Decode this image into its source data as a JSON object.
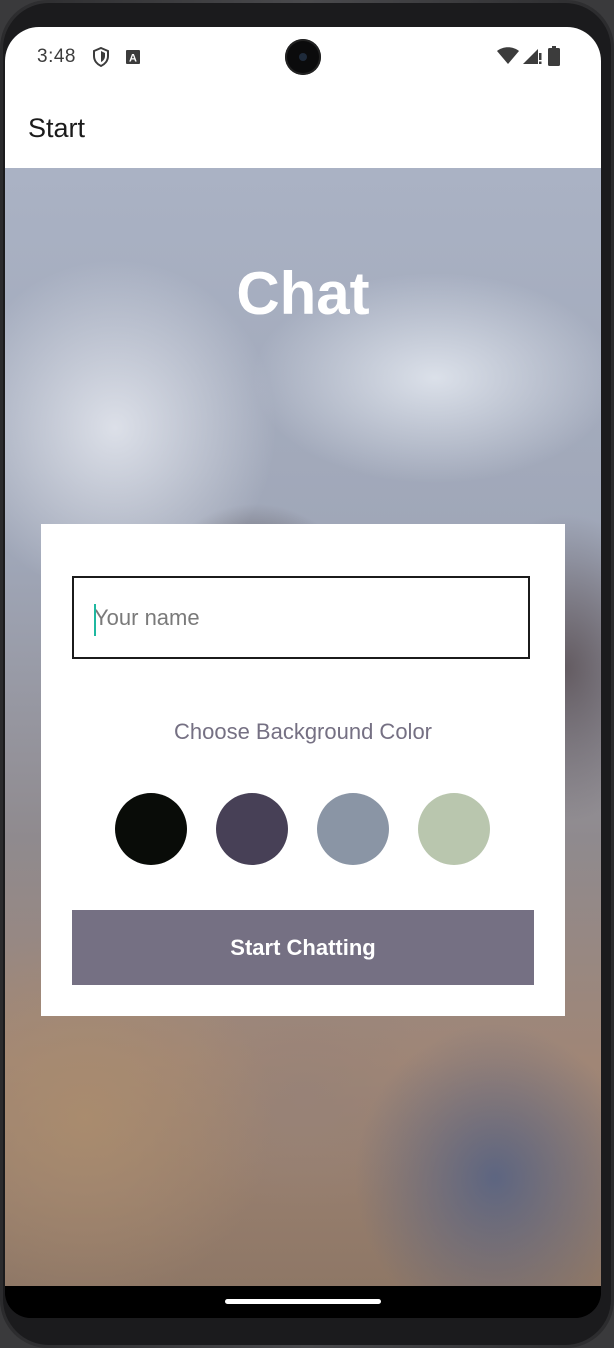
{
  "status_bar": {
    "time": "3:48",
    "icons": [
      "shield-icon",
      "a-notification-icon",
      "wifi-icon",
      "signal-icon",
      "battery-icon"
    ]
  },
  "app_bar": {
    "title": "Start"
  },
  "main": {
    "title": "Chat",
    "name_input": {
      "placeholder": "Your name",
      "value": ""
    },
    "color_label": "Choose Background Color",
    "colors": [
      "#090C08",
      "#474056",
      "#8A95A5",
      "#B9C6AE"
    ],
    "start_button_label": "Start Chatting",
    "start_button_color": "#757083"
  },
  "nav_bar": {
    "icons": [
      "home-indicator"
    ]
  }
}
